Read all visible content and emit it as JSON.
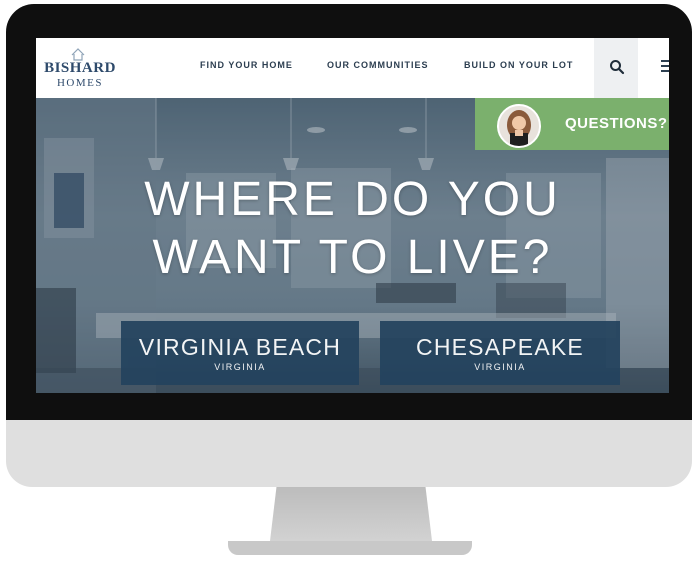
{
  "brand": {
    "name_line1": "BISHARD",
    "name_line2": "HOMES",
    "color": "#2e4a6b"
  },
  "nav": {
    "items": [
      {
        "label": "FIND YOUR HOME"
      },
      {
        "label": "OUR COMMUNITIES"
      },
      {
        "label": "BUILD ON YOUR LOT"
      }
    ],
    "search_icon": "search-icon",
    "menu_icon": "menu-icon"
  },
  "chat": {
    "label": "QUESTIONS?",
    "accent": "#7bb06d"
  },
  "hero": {
    "line1": "WHERE DO YOU",
    "line2": "WANT TO LIVE?",
    "locations": [
      {
        "title": "VIRGINIA BEACH",
        "subtitle": "VIRGINIA"
      },
      {
        "title": "CHESAPEAKE",
        "subtitle": "VIRGINIA"
      }
    ],
    "button_color": "#24435e"
  }
}
